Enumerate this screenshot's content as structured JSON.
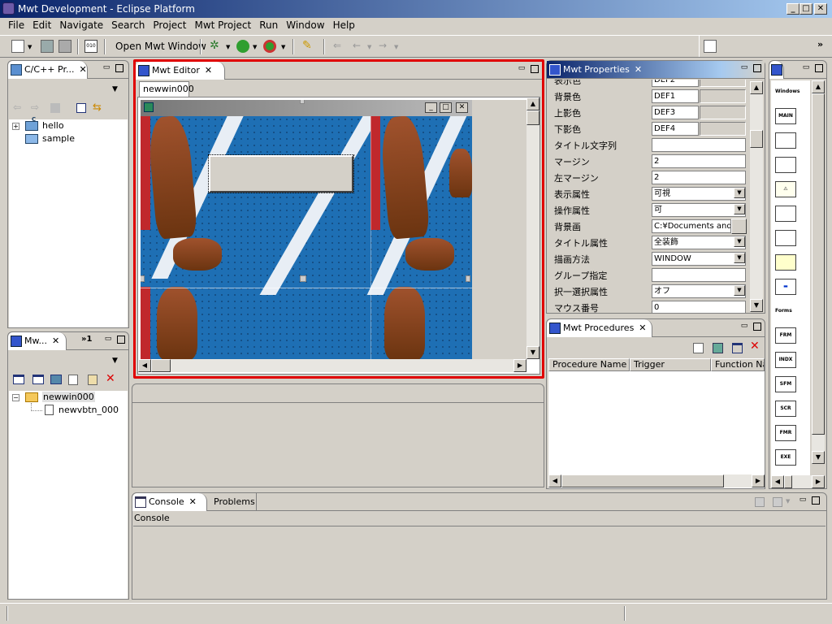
{
  "window": {
    "title": "Mwt Development - Eclipse Platform",
    "controls": [
      "_",
      "□",
      "✕"
    ]
  },
  "menu": [
    "File",
    "Edit",
    "Navigate",
    "Search",
    "Project",
    "Mwt Project",
    "Run",
    "Window",
    "Help"
  ],
  "toolbar": {
    "open_label": "Open Mwt Window",
    "more": "»"
  },
  "cpp_explorer": {
    "tab": "C/C++ Pr...",
    "items": [
      "hello",
      "sample"
    ],
    "hello_marker": "C"
  },
  "mwt_view": {
    "tab": "Mw...",
    "overflow": "»1",
    "root": "newwin000",
    "child": "newvbtn_000"
  },
  "editor": {
    "tab": "Mwt Editor",
    "subtab": "newwin000"
  },
  "properties": {
    "tab": "Mwt Properties",
    "rows": [
      {
        "k": "表示色",
        "v": "DEF2",
        "swatch": true
      },
      {
        "k": "背景色",
        "v": "DEF1",
        "swatch": true
      },
      {
        "k": "上影色",
        "v": "DEF3",
        "swatch": true
      },
      {
        "k": "下影色",
        "v": "DEF4",
        "swatch": true
      },
      {
        "k": "タイトル文字列",
        "v": ""
      },
      {
        "k": "マージン",
        "v": "2"
      },
      {
        "k": "左マージン",
        "v": "2"
      },
      {
        "k": "表示属性",
        "v": "可視",
        "dropdown": true
      },
      {
        "k": "操作属性",
        "v": "可",
        "dropdown": true
      },
      {
        "k": "背景画",
        "v": "C:¥Documents and",
        "browse": true
      },
      {
        "k": "タイトル属性",
        "v": "全装飾",
        "dropdown": true
      },
      {
        "k": "描画方法",
        "v": "WINDOW",
        "dropdown": true
      },
      {
        "k": "グループ指定",
        "v": ""
      },
      {
        "k": "択一選択属性",
        "v": "オフ",
        "dropdown": true
      },
      {
        "k": "マウス番号",
        "v": "0"
      }
    ]
  },
  "procedures": {
    "tab": "Mwt Procedures",
    "columns": [
      "Procedure Name",
      "Trigger",
      "Function Na"
    ]
  },
  "palette": {
    "section1": "Windows",
    "buttons1": [
      "MAIN",
      "",
      "",
      "⚠",
      "",
      "",
      "",
      "▬"
    ],
    "section2": "Forms",
    "buttons2": [
      "FRM",
      "INDX",
      "SFM",
      "SCR",
      "FMR",
      "EXE"
    ]
  },
  "console": {
    "tabs": [
      "Console",
      "Problems"
    ],
    "header": "Console"
  },
  "colors": {
    "highlight": "#e00000",
    "title_start": "#0a246a",
    "title_end": "#a6caf0",
    "track_blue": "#1e6fb4"
  }
}
